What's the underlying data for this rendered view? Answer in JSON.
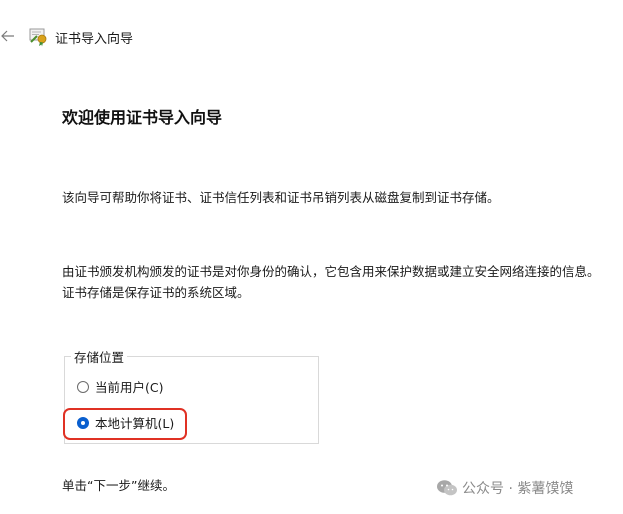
{
  "titlebar": {
    "title": "证书导入向导",
    "back_icon": "arrow-left-icon",
    "app_icon": "certificate-icon"
  },
  "main": {
    "heading": "欢迎使用证书导入向导",
    "paragraph1": "该向导可帮助你将证书、证书信任列表和证书吊销列表从磁盘复制到证书存储。",
    "paragraph2": "由证书颁发机构颁发的证书是对你身份的确认，它包含用来保护数据或建立安全网络连接的信息。证书存储是保存证书的系统区域。"
  },
  "store_location": {
    "legend": "存储位置",
    "options": [
      {
        "label": "当前用户(C)",
        "selected": false
      },
      {
        "label": "本地计算机(L)",
        "selected": true
      }
    ]
  },
  "footer_note": "单击“下一步”继续。",
  "watermark": {
    "text": "公众号 · 紫薯馍馍",
    "logo_icon": "wechat-logo-icon"
  },
  "colors": {
    "accent": "#0a5fcf",
    "highlight": "#e03124"
  }
}
